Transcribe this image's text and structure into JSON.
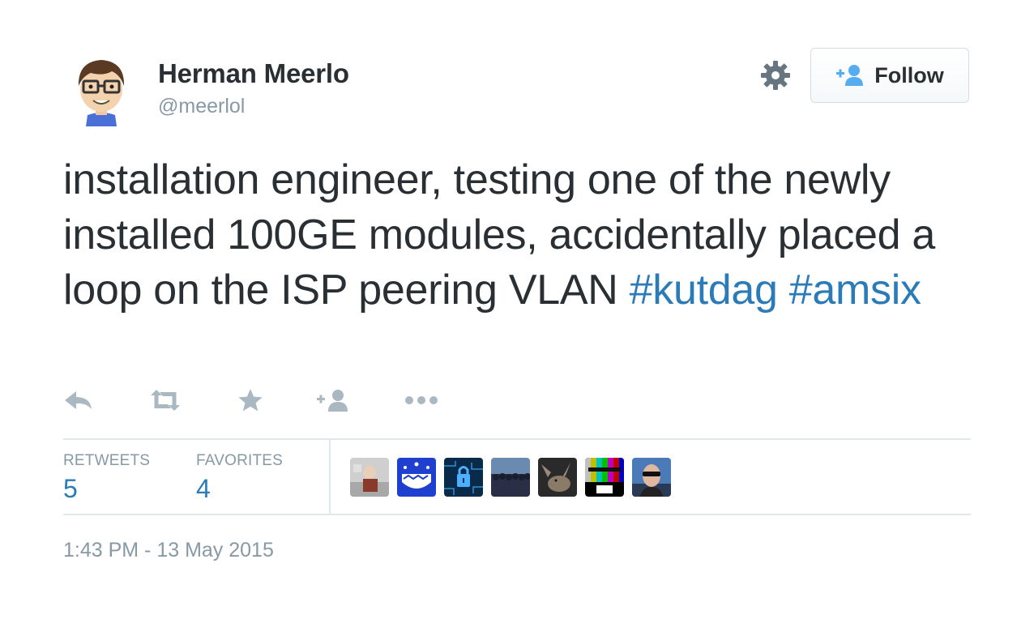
{
  "author": {
    "name": "Herman Meerlo",
    "handle": "@meerlol"
  },
  "follow_button": {
    "label": "Follow"
  },
  "tweet": {
    "text_before": "installation engineer, testing one of the newly installed 100GE modules, accidentally placed a loop on the ISP peering VLAN",
    "hashtags": [
      "#kutdag",
      "#amsix"
    ]
  },
  "actions": [
    "reply-icon",
    "retweet-icon",
    "favorite-star-icon",
    "follow-user-icon",
    "more-dots-icon"
  ],
  "stats": {
    "retweets_label": "RETWEETS",
    "retweets_count": "5",
    "favorites_label": "FAVORITES",
    "favorites_count": "4"
  },
  "favorited_by_count": 7,
  "timestamp": "1:43 PM - 13 May 2015",
  "colors": {
    "text": "#292f33",
    "muted": "#8899a6",
    "link": "#2b7bb9",
    "divider": "#e1e8ed"
  }
}
